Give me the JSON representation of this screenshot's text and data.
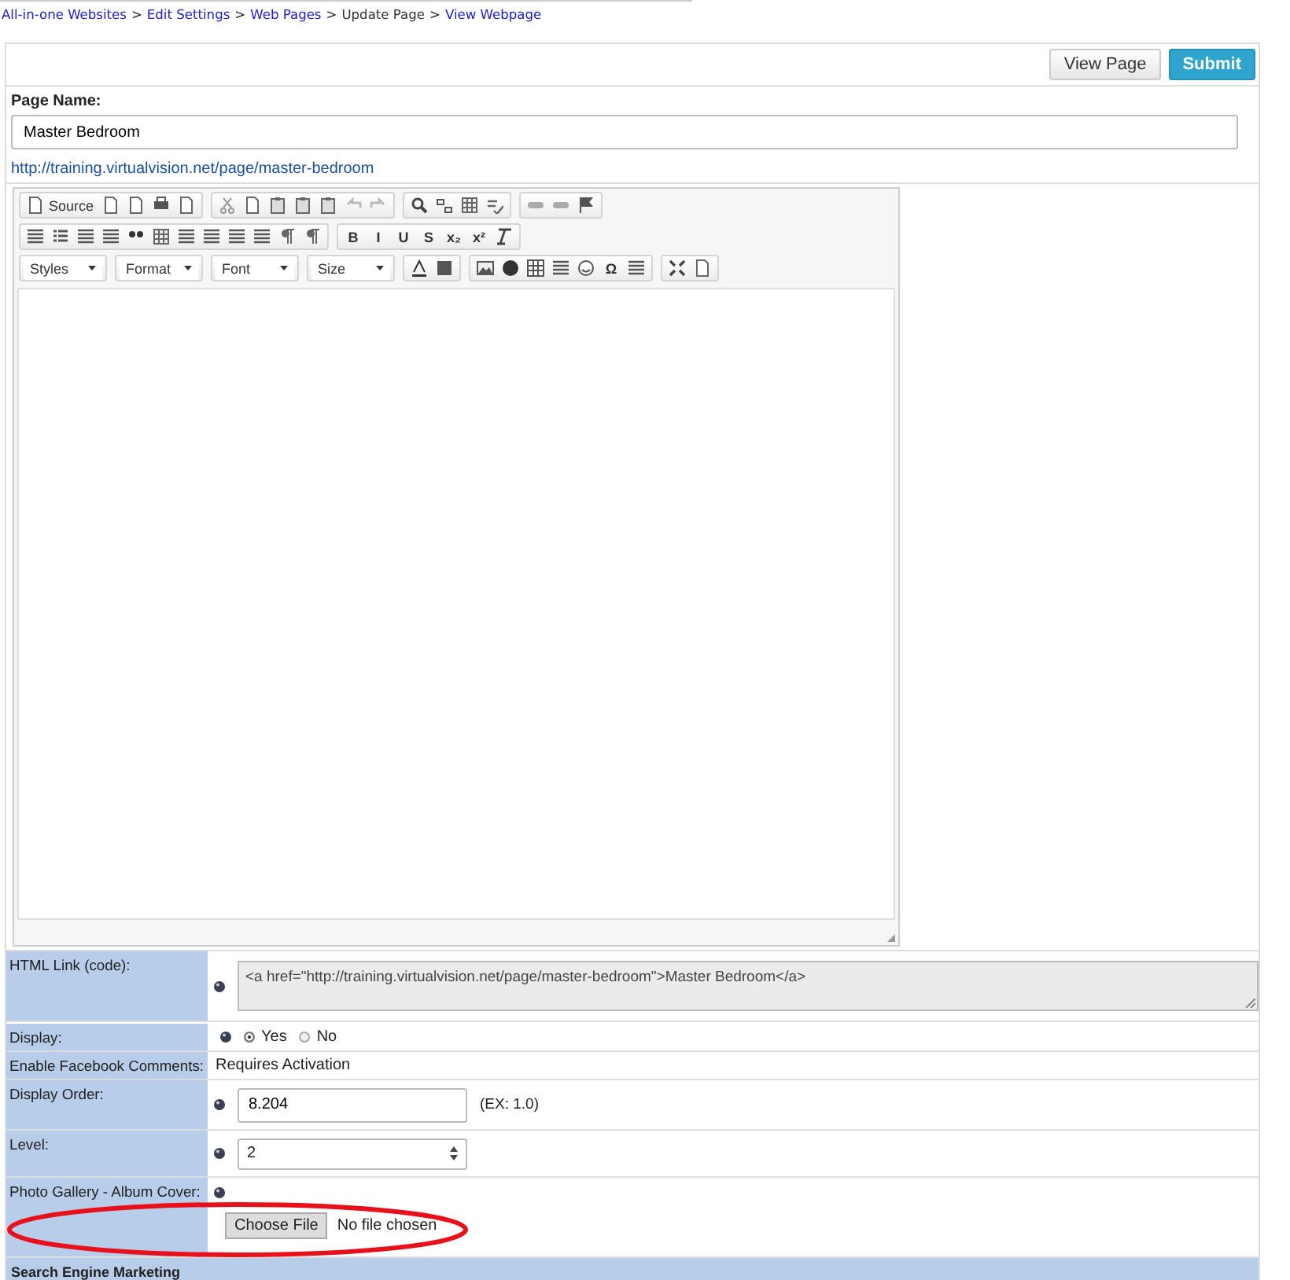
{
  "breadcrumb": {
    "separator": ">",
    "items": [
      {
        "label": "All-in-one Websites",
        "link": true
      },
      {
        "label": "Edit Settings",
        "link": true
      },
      {
        "label": "Web Pages",
        "link": true
      },
      {
        "label": "Update Page",
        "link": false
      },
      {
        "label": "View Webpage",
        "link": true
      }
    ]
  },
  "actions": [
    {
      "label": "View Page",
      "primary": false
    },
    {
      "label": "Submit",
      "primary": true
    }
  ],
  "page_name": {
    "label": "Page Name:",
    "value": "Master Bedroom",
    "url": "http://training.virtualvision.net/page/master-bedroom"
  },
  "toolbar": [
    [
      [
        {
          "kind": "labeled",
          "label": "Source"
        },
        {
          "kind": "icon"
        },
        {
          "kind": "icon"
        },
        {
          "kind": "icon"
        },
        {
          "kind": "icon"
        }
      ],
      [
        {
          "kind": "icon"
        },
        {
          "kind": "icon"
        },
        {
          "kind": "icon"
        },
        {
          "kind": "icon"
        },
        {
          "kind": "icon"
        },
        {
          "kind": "icon"
        },
        {
          "kind": "icon"
        }
      ],
      [
        {
          "kind": "icon"
        },
        {
          "kind": "icon"
        },
        {
          "kind": "icon"
        },
        {
          "kind": "icon"
        }
      ],
      [
        {
          "kind": "icon"
        },
        {
          "kind": "icon"
        },
        {
          "kind": "icon"
        }
      ]
    ],
    [
      [
        {
          "kind": "icon"
        },
        {
          "kind": "icon"
        },
        {
          "kind": "icon"
        },
        {
          "kind": "icon"
        },
        {
          "kind": "icon"
        },
        {
          "kind": "icon"
        },
        {
          "kind": "icon"
        },
        {
          "kind": "icon"
        },
        {
          "kind": "icon"
        },
        {
          "kind": "icon"
        },
        {
          "kind": "icon"
        },
        {
          "kind": "icon"
        }
      ],
      [
        {
          "kind": "text",
          "label": "B"
        },
        {
          "kind": "text",
          "label": "I"
        },
        {
          "kind": "text",
          "label": "U"
        },
        {
          "kind": "text",
          "label": "S"
        },
        {
          "kind": "text",
          "label": "x₂"
        },
        {
          "kind": "text",
          "label": "x²"
        },
        {
          "kind": "icon"
        }
      ]
    ],
    [
      [
        {
          "kind": "combo",
          "label": "Styles"
        }
      ],
      [
        {
          "kind": "combo",
          "label": "Format"
        }
      ],
      [
        {
          "kind": "combo",
          "label": "Font"
        }
      ],
      [
        {
          "kind": "combo",
          "label": "Size"
        }
      ],
      [
        {
          "kind": "icon"
        },
        {
          "kind": "icon"
        }
      ],
      [
        {
          "kind": "icon"
        },
        {
          "kind": "icon"
        },
        {
          "kind": "icon"
        },
        {
          "kind": "icon"
        },
        {
          "kind": "icon"
        },
        {
          "kind": "text",
          "label": "Ω"
        },
        {
          "kind": "icon"
        }
      ],
      [
        {
          "kind": "icon"
        },
        {
          "kind": "icon"
        }
      ]
    ]
  ],
  "fields": [
    {
      "label": "HTML Link (code):",
      "kind": "textarea",
      "info": true,
      "value": "<a href=\"http://training.virtualvision.net/page/master-bedroom\">Master Bedroom</a>"
    },
    {
      "label": "Display:",
      "kind": "radio",
      "info": true,
      "options": [
        {
          "label": "Yes",
          "selected": true
        },
        {
          "label": "No",
          "selected": false
        }
      ]
    },
    {
      "label": "Enable Facebook Comments:",
      "kind": "text",
      "info": false,
      "value": "Requires Activation"
    },
    {
      "label": "Display Order:",
      "kind": "input",
      "info": true,
      "value": "8.204",
      "hint": "(EX: 1.0)"
    },
    {
      "label": "Level:",
      "kind": "select",
      "info": true,
      "value": "2"
    },
    {
      "label": "Photo Gallery - Album Cover:",
      "kind": "file",
      "info": true,
      "button": "Choose File",
      "status": "No file chosen"
    }
  ],
  "section": "Search Engine Marketing"
}
